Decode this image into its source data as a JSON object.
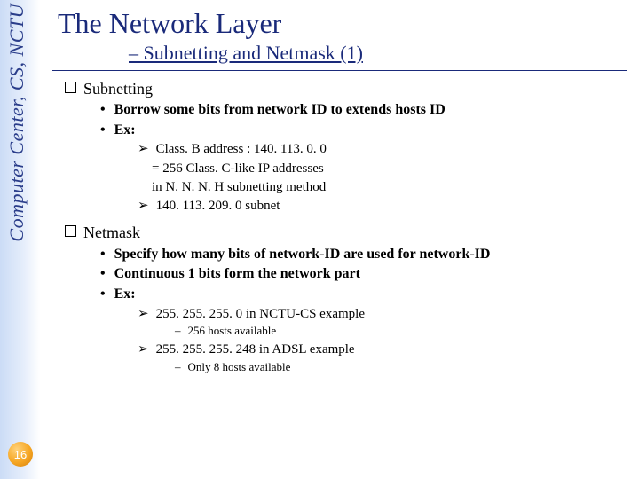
{
  "sidebar": {
    "label": "Computer Center, CS, NCTU"
  },
  "page_number": "16",
  "title": "The Network Layer",
  "subtitle": "– Subnetting and Netmask (1)",
  "sections": {
    "subnetting": {
      "heading": "Subnetting",
      "b1": "Borrow some bits from network ID to extends hosts ID",
      "b2": "Ex:",
      "t1": "Class. B address : 140. 113. 0. 0",
      "t1b": "= 256 Class. C-like IP addresses",
      "t1c": "in N. N. N. H subnetting method",
      "t2": "140. 113. 209. 0 subnet"
    },
    "netmask": {
      "heading": "Netmask",
      "b1": "Specify how many bits of network-ID are used for network-ID",
      "b2": "Continuous 1 bits form the network part",
      "b3": "Ex:",
      "t1": "255. 255. 255. 0 in NCTU-CS example",
      "d1": "256 hosts available",
      "t2": "255. 255. 255. 248 in ADSL example",
      "d2": "Only 8 hosts available"
    }
  }
}
